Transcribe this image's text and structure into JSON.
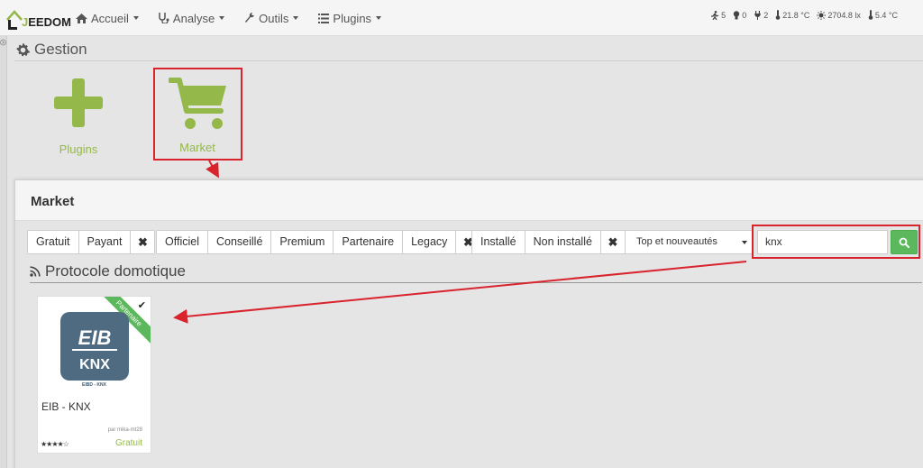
{
  "app": {
    "logo_text": "EEDOM",
    "logo_initial": "J"
  },
  "nav": {
    "items": [
      {
        "label": "Accueil",
        "icon": "home-icon"
      },
      {
        "label": "Analyse",
        "icon": "stethoscope-icon"
      },
      {
        "label": "Outils",
        "icon": "wrench-icon"
      },
      {
        "label": "Plugins",
        "icon": "tasks-icon"
      }
    ]
  },
  "status": {
    "motion_count": "5",
    "light_count": "0",
    "plug_count": "2",
    "temperature_in": "21.8 °C",
    "luminosity": "2704.8 lx",
    "temperature_out": "5.4 °C"
  },
  "gestion": {
    "title": "Gestion",
    "tiles": [
      {
        "label": "Plugins",
        "icon": "plus-icon"
      },
      {
        "label": "Market",
        "icon": "cart-icon"
      }
    ]
  },
  "modal": {
    "title": "Market",
    "filters": {
      "price": [
        "Gratuit",
        "Payant"
      ],
      "type": [
        "Officiel",
        "Conseillé",
        "Premium",
        "Partenaire",
        "Legacy"
      ],
      "install": [
        "Installé",
        "Non installé"
      ],
      "clear_symbol": "✖"
    },
    "sort": {
      "selected": "Top et nouveautés"
    },
    "search": {
      "value": "knx"
    },
    "category": "Protocole domotique",
    "plugins": [
      {
        "name": "EIB - KNX",
        "logo_top": "EIB",
        "logo_bottom": "KNX",
        "logo_caption": "EIBD - KNX",
        "ribbon": "Partenaire",
        "installed_mark": "✔",
        "author": "par mika-mt28",
        "rating_stars": "★★★★☆",
        "price": "Gratuit"
      }
    ]
  },
  "colors": {
    "accent_green": "#94b84a",
    "button_green": "#5cb85c",
    "annotation_red": "#d9232d",
    "logo_blue": "#4f6b82"
  }
}
